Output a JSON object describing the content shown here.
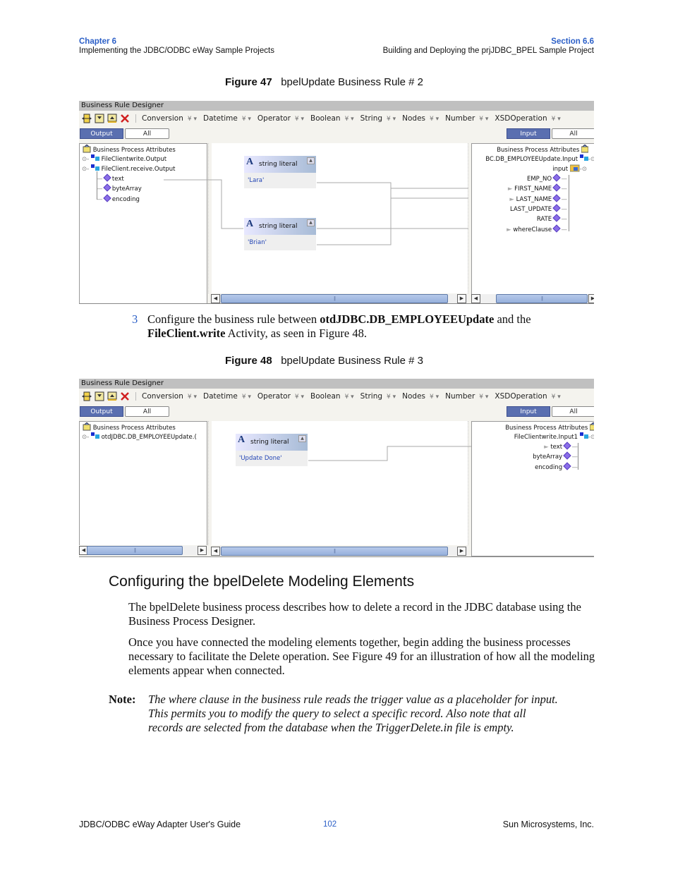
{
  "header": {
    "left_chapter": "Chapter 6",
    "left_title": "Implementing the JDBC/ODBC eWay Sample Projects",
    "right_section": "Section 6.6",
    "right_title": "Building and Deploying the prjJDBC_BPEL Sample Project"
  },
  "figure47": {
    "caption_label": "Figure 47",
    "caption_text": "bpelUpdate Business Rule # 2",
    "window_title": "Business Rule Designer",
    "toolbar_icons": [
      "toggle-panel-icon",
      "expand-icon",
      "collapse-icon",
      "delete-icon"
    ],
    "menus": [
      "Conversion",
      "Datetime",
      "Operator",
      "Boolean",
      "String",
      "Nodes",
      "Number",
      "XSDOperation"
    ],
    "left_tabs": {
      "active": "Output",
      "other": "All"
    },
    "right_tabs": {
      "active": "Input",
      "other": "All"
    },
    "left_tree": {
      "root": "Business Process Attributes",
      "items": [
        "FileClientwrite.Output",
        "FileClient.receive.Output"
      ],
      "children": [
        "text",
        "byteArray",
        "encoding"
      ]
    },
    "literals": [
      {
        "title": "string literal",
        "value": "'Lara'"
      },
      {
        "title": "string literal",
        "value": "'Brian'"
      }
    ],
    "right_tree": {
      "root": "Business Process Attributes",
      "node": "BC.DB_EMPLOYEEUpdate.Input",
      "sub": "input",
      "fields": [
        "EMP_NO",
        "FIRST_NAME",
        "LAST_NAME",
        "LAST_UPDATE",
        "RATE",
        "whereClause"
      ]
    }
  },
  "step3": {
    "number": "3",
    "text_a": "Configure the business rule between ",
    "bold_a": "otdJDBC.DB_EMPLOYEEUpdate",
    "text_b": " and the ",
    "bold_b": "FileClient.write",
    "text_c": " Activity, as seen in Figure 48."
  },
  "figure48": {
    "caption_label": "Figure 48",
    "caption_text": "bpelUpdate Business Rule # 3",
    "window_title": "Business Rule Designer",
    "menus": [
      "Conversion",
      "Datetime",
      "Operator",
      "Boolean",
      "String",
      "Nodes",
      "Number",
      "XSDOperation"
    ],
    "left_tabs": {
      "active": "Output",
      "other": "All"
    },
    "right_tabs": {
      "active": "Input",
      "other": "All"
    },
    "left_tree": {
      "root": "Business Process Attributes",
      "items": [
        "otdJDBC.DB_EMPLOYEEUpdate.("
      ]
    },
    "literal": {
      "title": "string literal",
      "value": "'Update Done'"
    },
    "right_tree": {
      "root": "Business Process Attributes",
      "node": "FileClientwrite.Input1",
      "fields": [
        "text",
        "byteArray",
        "encoding"
      ]
    }
  },
  "section": {
    "heading": "Configuring the bpelDelete Modeling Elements",
    "para1": "The bpelDelete business process describes how to delete a record in the JDBC database using the Business Process Designer.",
    "para2": "Once you have connected the modeling elements together, begin adding the business processes necessary to facilitate the Delete operation. See Figure 49 for an illustration of how all the modeling elements appear when connected.",
    "note_label": "Note:",
    "note_text": "The where clause in the business rule reads the trigger value as a placeholder for input. This permits you to modify the query to select a specific record. Also note that all records are selected from the database when the TriggerDelete.in file is empty."
  },
  "footer": {
    "left": "JDBC/ODBC eWay Adapter User's Guide",
    "page": "102",
    "right": "Sun Microsystems, Inc."
  },
  "colors": {
    "accent_blue": "#2b5fc7",
    "tab_active": "#5a6fb0",
    "scroll_thumb": "#a7bde3",
    "port_diamond": "#8a6ee8"
  }
}
